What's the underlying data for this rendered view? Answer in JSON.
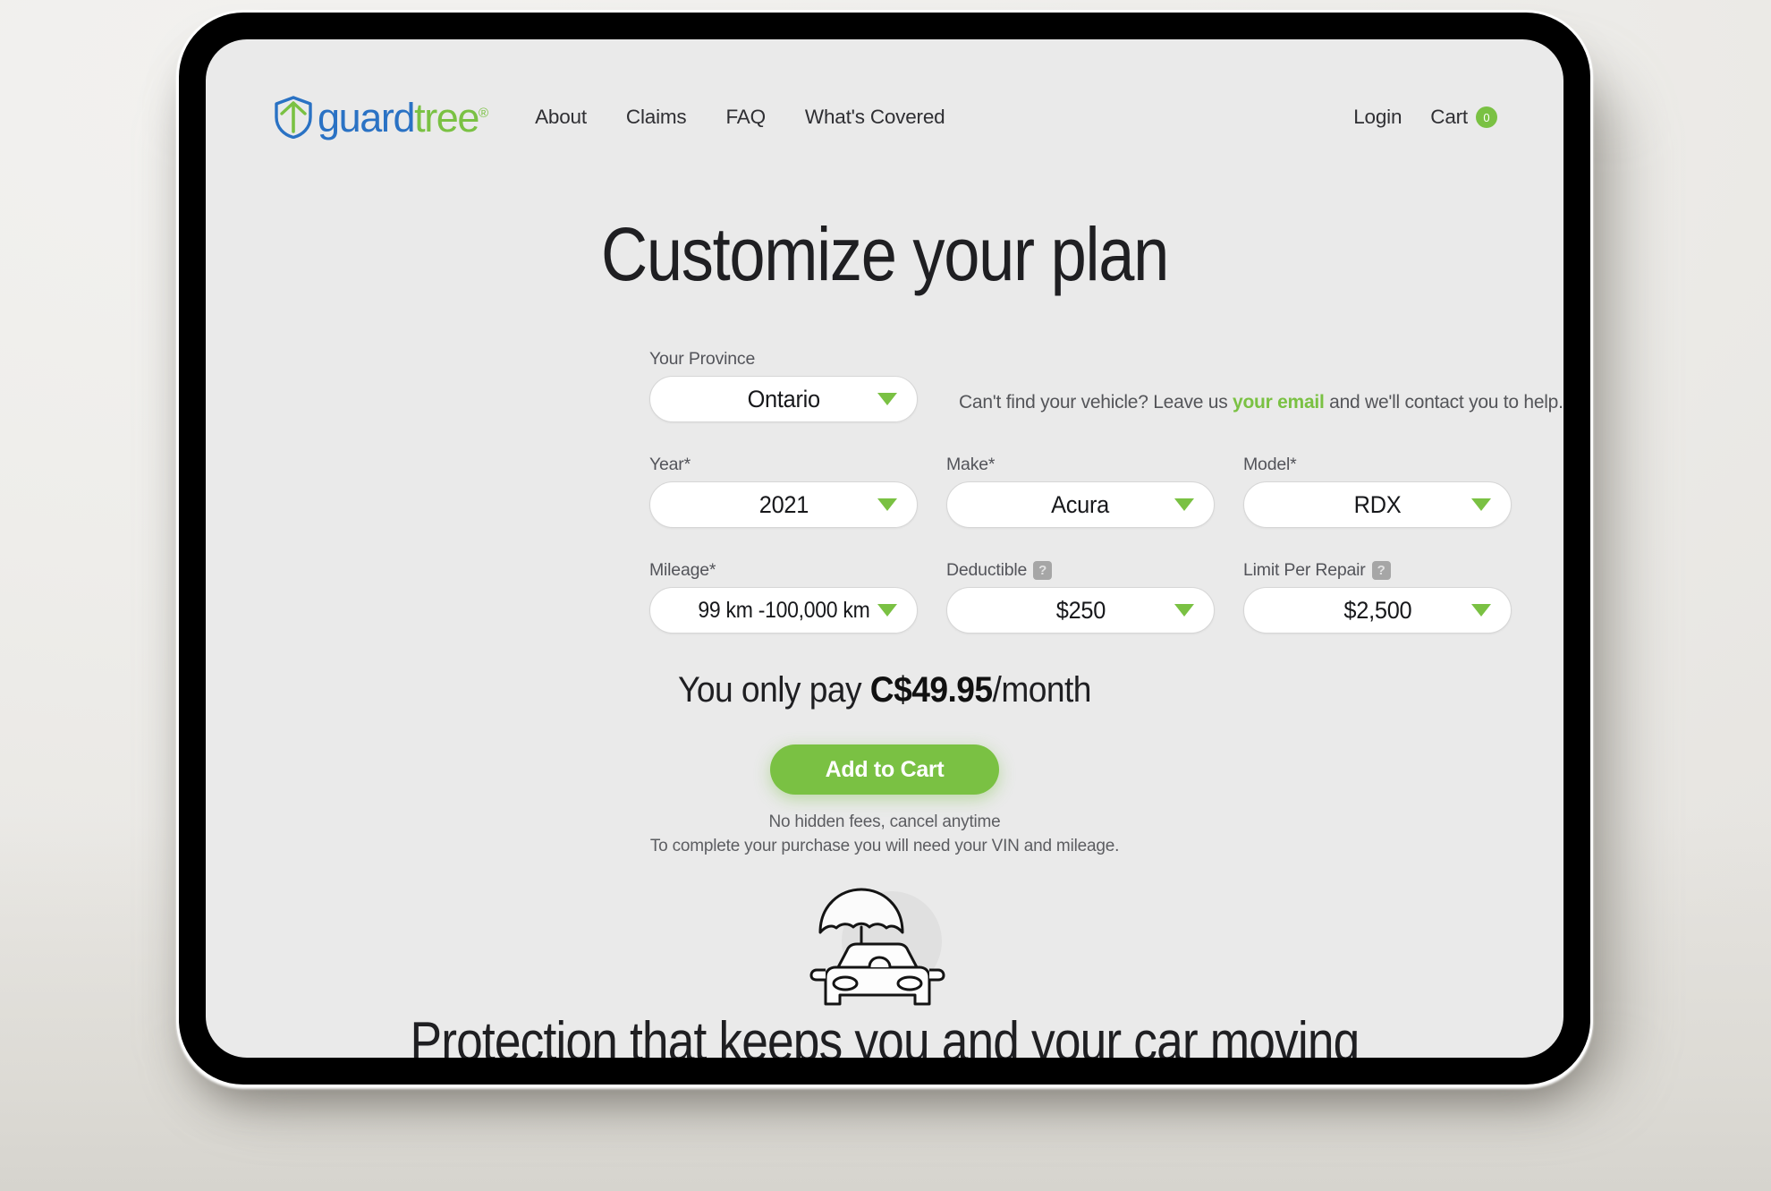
{
  "header": {
    "brand": {
      "icon": "shield-tree-logo-icon",
      "word_part1": "guard",
      "word_part2": "tree",
      "registered_mark": "®"
    },
    "nav": [
      {
        "label": "About"
      },
      {
        "label": "Claims"
      },
      {
        "label": "FAQ"
      },
      {
        "label": "What's Covered"
      }
    ],
    "login_label": "Login",
    "cart_label": "Cart",
    "cart_count": "0",
    "cart_badge_color": "#7ac143"
  },
  "page": {
    "title": "Customize your plan"
  },
  "form": {
    "province": {
      "label": "Your Province",
      "value": "Ontario",
      "caret_icon": "chevron-down-icon"
    },
    "helper": {
      "before": "Can't find your vehicle? Leave us ",
      "link": "your email",
      "after": " and we'll contact you to help."
    },
    "year": {
      "label": "Year*",
      "value": "2021"
    },
    "make": {
      "label": "Make*",
      "value": "Acura"
    },
    "model": {
      "label": "Model*",
      "value": "RDX"
    },
    "mileage": {
      "label": "Mileage*",
      "value": "99 km -100,000 km"
    },
    "deductible": {
      "label": "Deductible",
      "help_icon": "?",
      "value": "$250"
    },
    "limit_per_repair": {
      "label": "Limit Per Repair",
      "help_icon": "?",
      "value": "$2,500"
    }
  },
  "pricing": {
    "prefix": "You only pay ",
    "amount": "C$49.95",
    "suffix": "/month",
    "cta_label": "Add to Cart",
    "cta_color": "#7ac143",
    "fineprint_line1": "No hidden fees, cancel anytime",
    "fineprint_line2": "To complete your purchase you will need your VIN and mileage."
  },
  "footer": {
    "illustration_icon": "car-with-umbrella-icon",
    "headline": "Protection that keeps you and your car moving"
  },
  "colors": {
    "accent_green": "#7ac143",
    "brand_blue": "#2a72c4",
    "screen_background": "#eaeaea",
    "page_background": "#efeeec"
  }
}
